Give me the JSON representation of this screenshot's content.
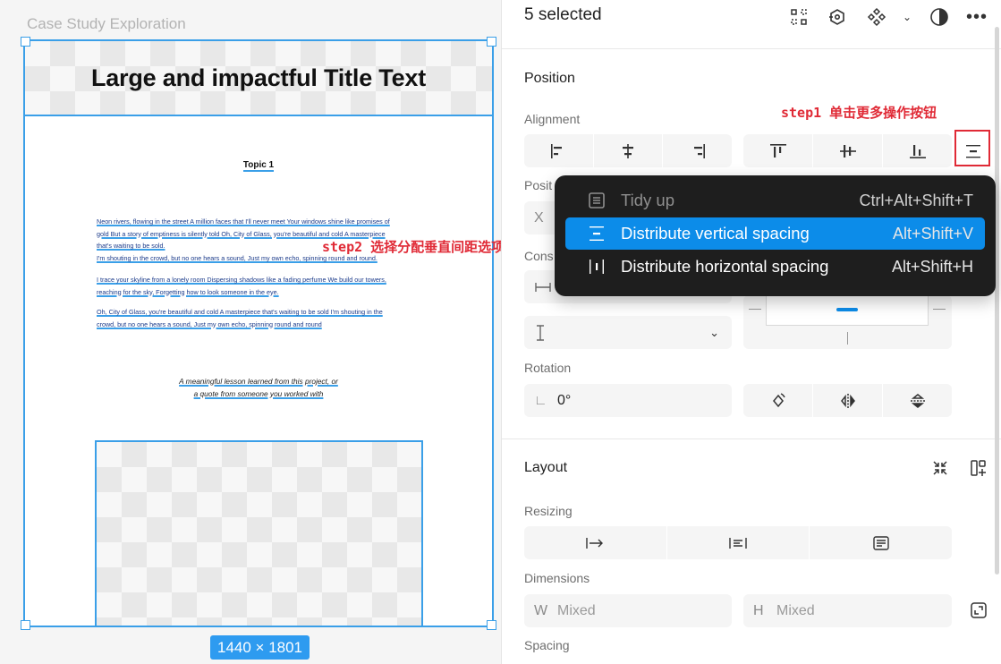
{
  "canvas": {
    "frame_name": "Case Study Exploration",
    "title": "Large and impactful Title Text",
    "topic": "Topic 1",
    "paragraphs": [
      [
        "Neon rivers, flowing in the street A million faces that I'll never meet Your windows shine like promises of",
        "gold But a story of emptiness is silently told Oh, City of Glass, you're beautiful and cold A masterpiece",
        "that's waiting to be sold.",
        "I'm shouting in the crowd, but no one hears a sound, Just my own echo, spinning round and round."
      ],
      [
        "I trace your skyline from a lonely room Dispersing shadows like a fading perfume We build our towers,",
        "reaching for the sky, Forgetting how to look someone in the eye."
      ],
      [
        "Oh, City of Glass, you're beautiful and cold A masterpiece that's waiting to be sold I'm shouting in the",
        "crowd, but no one hears a sound, Just my own echo, spinning round and round"
      ]
    ],
    "quote": [
      "A meaningful lesson learned from this project, or",
      "a quote from someone you worked with"
    ],
    "size_badge": "1440 × 1801",
    "annotation_step2": "step2 选择分配垂直间距选项"
  },
  "panel": {
    "selected_count": "5 selected",
    "annotation_step1": "step1 单击更多操作按钮",
    "position": {
      "title": "Position",
      "alignment_label": "Alignment",
      "position_label_partial": "Posit",
      "x_key": "X",
      "constraints_label_partial": "Cons"
    },
    "rotation": {
      "label": "Rotation",
      "value": "0°"
    },
    "layout": {
      "title": "Layout",
      "resizing_label": "Resizing",
      "dimensions_label": "Dimensions",
      "w_key": "W",
      "w_value": "Mixed",
      "h_key": "H",
      "h_value": "Mixed",
      "spacing_label": "Spacing"
    }
  },
  "menu": {
    "items": [
      {
        "label": "Tidy up",
        "shortcut": "Ctrl+Alt+Shift+T",
        "icon": "tidy-up-icon",
        "state": "disabled"
      },
      {
        "label": "Distribute vertical spacing",
        "shortcut": "Alt+Shift+V",
        "icon": "distribute-vertical-icon",
        "state": "active"
      },
      {
        "label": "Distribute horizontal spacing",
        "shortcut": "Alt+Shift+H",
        "icon": "distribute-horizontal-icon",
        "state": "normal"
      }
    ]
  },
  "colors": {
    "accent": "#0c8ce9",
    "selection": "#3a9fe8",
    "annotation": "#e02a36",
    "menu_bg": "#1e1e1e"
  }
}
